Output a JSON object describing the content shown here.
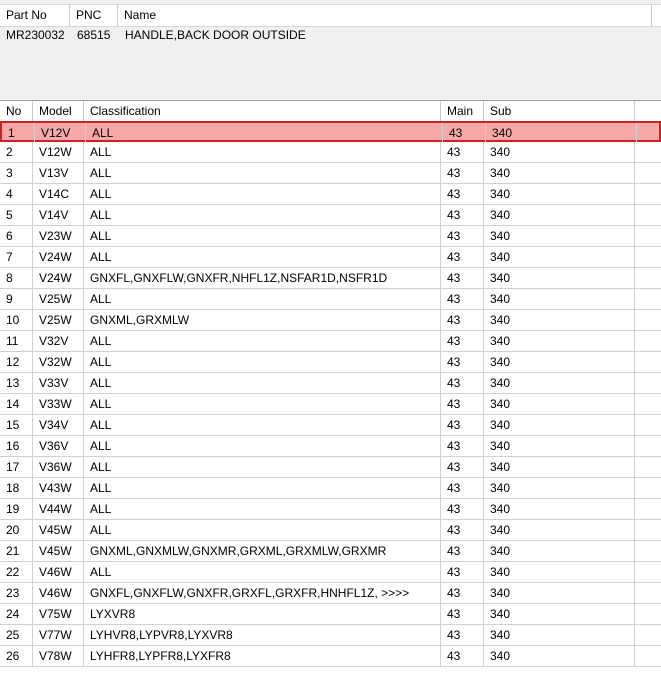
{
  "parts": {
    "headers": {
      "part_no": "Part No",
      "pnc": "PNC",
      "name": "Name"
    },
    "row": {
      "part_no": "MR230032",
      "pnc": "68515",
      "name": "HANDLE,BACK DOOR OUTSIDE"
    }
  },
  "models": {
    "headers": {
      "no": "No",
      "model": "Model",
      "classification": "Classification",
      "main": "Main",
      "sub": "Sub"
    },
    "selected_index": 0,
    "rows": [
      {
        "no": "1",
        "model": "V12V",
        "classification": "ALL",
        "main": "43",
        "sub": "340"
      },
      {
        "no": "2",
        "model": "V12W",
        "classification": "ALL",
        "main": "43",
        "sub": "340"
      },
      {
        "no": "3",
        "model": "V13V",
        "classification": "ALL",
        "main": "43",
        "sub": "340"
      },
      {
        "no": "4",
        "model": "V14C",
        "classification": "ALL",
        "main": "43",
        "sub": "340"
      },
      {
        "no": "5",
        "model": "V14V",
        "classification": "ALL",
        "main": "43",
        "sub": "340"
      },
      {
        "no": "6",
        "model": "V23W",
        "classification": "ALL",
        "main": "43",
        "sub": "340"
      },
      {
        "no": "7",
        "model": "V24W",
        "classification": "ALL",
        "main": "43",
        "sub": "340"
      },
      {
        "no": "8",
        "model": "V24W",
        "classification": "GNXFL,GNXFLW,GNXFR,NHFL1Z,NSFAR1D,NSFR1D",
        "main": "43",
        "sub": "340"
      },
      {
        "no": "9",
        "model": "V25W",
        "classification": "ALL",
        "main": "43",
        "sub": "340"
      },
      {
        "no": "10",
        "model": "V25W",
        "classification": "GNXML,GRXMLW",
        "main": "43",
        "sub": "340"
      },
      {
        "no": "11",
        "model": "V32V",
        "classification": "ALL",
        "main": "43",
        "sub": "340"
      },
      {
        "no": "12",
        "model": "V32W",
        "classification": "ALL",
        "main": "43",
        "sub": "340"
      },
      {
        "no": "13",
        "model": "V33V",
        "classification": "ALL",
        "main": "43",
        "sub": "340"
      },
      {
        "no": "14",
        "model": "V33W",
        "classification": "ALL",
        "main": "43",
        "sub": "340"
      },
      {
        "no": "15",
        "model": "V34V",
        "classification": "ALL",
        "main": "43",
        "sub": "340"
      },
      {
        "no": "16",
        "model": "V36V",
        "classification": "ALL",
        "main": "43",
        "sub": "340"
      },
      {
        "no": "17",
        "model": "V36W",
        "classification": "ALL",
        "main": "43",
        "sub": "340"
      },
      {
        "no": "18",
        "model": "V43W",
        "classification": "ALL",
        "main": "43",
        "sub": "340"
      },
      {
        "no": "19",
        "model": "V44W",
        "classification": "ALL",
        "main": "43",
        "sub": "340"
      },
      {
        "no": "20",
        "model": "V45W",
        "classification": "ALL",
        "main": "43",
        "sub": "340"
      },
      {
        "no": "21",
        "model": "V45W",
        "classification": "GNXML,GNXMLW,GNXMR,GRXML,GRXMLW,GRXMR",
        "main": "43",
        "sub": "340"
      },
      {
        "no": "22",
        "model": "V46W",
        "classification": "ALL",
        "main": "43",
        "sub": "340"
      },
      {
        "no": "23",
        "model": "V46W",
        "classification": "GNXFL,GNXFLW,GNXFR,GRXFL,GRXFR,HNHFL1Z,  >>>>",
        "main": "43",
        "sub": "340"
      },
      {
        "no": "24",
        "model": "V75W",
        "classification": "LYXVR8",
        "main": "43",
        "sub": "340"
      },
      {
        "no": "25",
        "model": "V77W",
        "classification": "LYHVR8,LYPVR8,LYXVR8",
        "main": "43",
        "sub": "340"
      },
      {
        "no": "26",
        "model": "V78W",
        "classification": "LYHFR8,LYPFR8,LYXFR8",
        "main": "43",
        "sub": "340"
      }
    ]
  },
  "colors": {
    "selection_fill": "#f7a8a8",
    "selection_border": "#cc2222"
  }
}
